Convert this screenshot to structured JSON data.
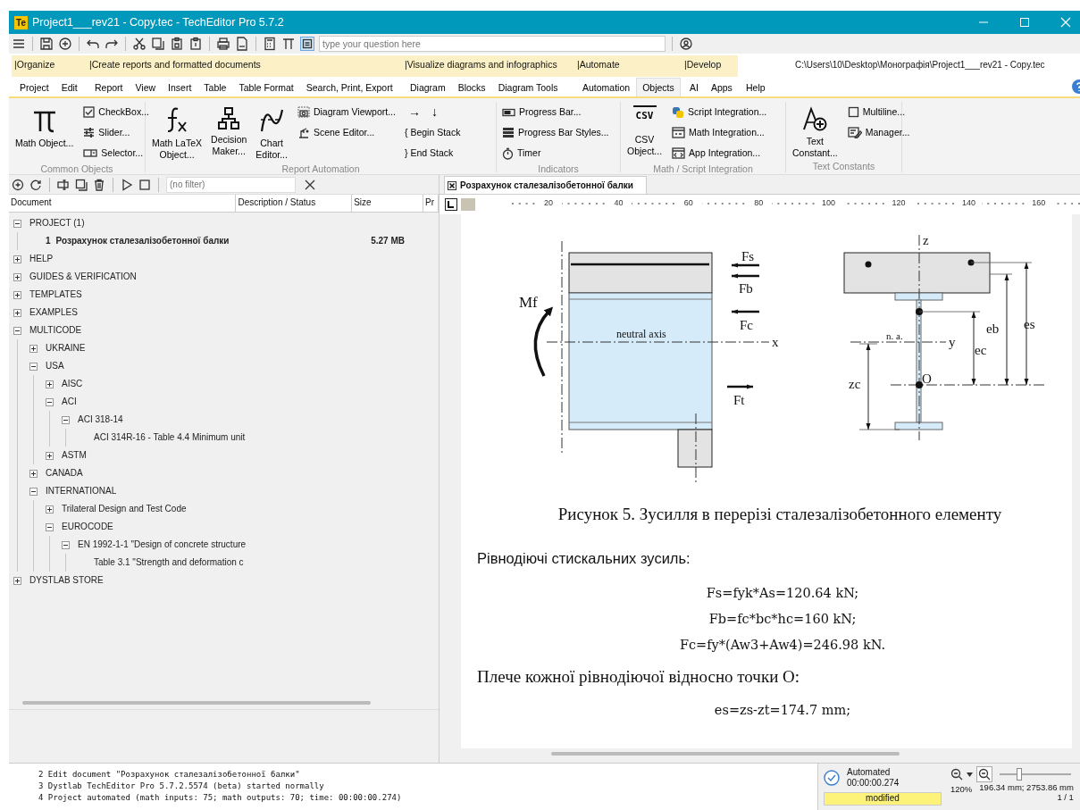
{
  "window": {
    "logo": "Te",
    "title": "Project1___rev21 - Copy.tec - TechEditor Pro 5.7.2"
  },
  "quick_search": {
    "placeholder": "type your question here"
  },
  "ribbon_tabs": {
    "groups": [
      {
        "label": "|Organize",
        "tabs": [
          {
            "label": "Project",
            "selected": false
          },
          {
            "label": "Edit",
            "selected": false
          }
        ]
      },
      {
        "label": "|Create reports and formatted documents",
        "tabs": [
          {
            "label": "Report",
            "selected": false
          },
          {
            "label": "View",
            "selected": false
          },
          {
            "label": "Insert",
            "selected": false
          },
          {
            "label": "Table",
            "selected": false
          },
          {
            "label": "Table Format",
            "selected": false
          },
          {
            "label": "Search, Print, Export",
            "selected": false
          }
        ]
      },
      {
        "label": "|Visualize diagrams and infographics",
        "tabs": [
          {
            "label": "Diagram",
            "selected": false
          },
          {
            "label": "Blocks",
            "selected": false
          },
          {
            "label": "Diagram Tools",
            "selected": false
          }
        ]
      },
      {
        "label": "|Automate",
        "tabs": [
          {
            "label": "Automation",
            "selected": false
          },
          {
            "label": "Objects",
            "selected": true
          }
        ]
      },
      {
        "label": "|Develop",
        "tabs": [
          {
            "label": "AI",
            "selected": false
          },
          {
            "label": "Apps",
            "selected": false
          }
        ]
      },
      {
        "tabs": [
          {
            "label": "Help",
            "selected": false
          }
        ]
      }
    ],
    "file_path": "C:\\Users\\10\\Desktop\\Монографія\\Project1___rev21 - Copy.tec"
  },
  "ribbon": [
    {
      "title": "Common Objects",
      "columns": [
        {
          "kind": "large",
          "items": [
            {
              "label": "Math Object..."
            }
          ]
        },
        {
          "kind": "small",
          "items": [
            {
              "kind": "command",
              "label": "CheckBox..."
            },
            {
              "kind": "command",
              "label": "Slider..."
            },
            {
              "kind": "command",
              "label": "Selector..."
            }
          ]
        }
      ]
    },
    {
      "title": "Report Automation",
      "columns": [
        {
          "kind": "large",
          "items": [
            {
              "label": "Math LaTeX\nObject..."
            },
            {
              "label": "Decision\nMaker..."
            },
            {
              "label": "Chart\nEditor..."
            }
          ]
        },
        {
          "kind": "small",
          "items": [
            {
              "kind": "command",
              "label": "Diagram Viewport..."
            },
            {
              "kind": "command",
              "label": "Scene Editor..."
            }
          ]
        },
        {
          "kind": "small",
          "items": [
            {
              "kind": "glyphs",
              "glyphs": [
                "→",
                "↓"
              ]
            },
            {
              "kind": "command",
              "label": "{ Begin Stack"
            },
            {
              "kind": "command",
              "label": "} End Stack"
            }
          ]
        }
      ]
    },
    {
      "title": "Indicators",
      "columns": [
        {
          "kind": "small",
          "items": [
            {
              "kind": "command",
              "label": "Progress Bar..."
            },
            {
              "kind": "command",
              "label": "Progress Bar Styles..."
            },
            {
              "kind": "command",
              "label": "Timer"
            }
          ]
        }
      ]
    },
    {
      "title": "Math / Script Integration",
      "columns": [
        {
          "kind": "large",
          "items": [
            {
              "label": "CSV\nObject...",
              "icon_text": "CSV"
            }
          ]
        },
        {
          "kind": "small",
          "items": [
            {
              "kind": "command",
              "label": "Script Integration..."
            },
            {
              "kind": "command",
              "label": "Math Integration..."
            },
            {
              "kind": "command",
              "label": "App Integration..."
            }
          ]
        }
      ]
    },
    {
      "title": "Text Constants",
      "columns": [
        {
          "kind": "large",
          "items": [
            {
              "label": "Text\nConstant..."
            }
          ]
        },
        {
          "kind": "small",
          "items": [
            {
              "kind": "command",
              "label": "Multiline..."
            },
            {
              "kind": "command",
              "label": "Manager..."
            }
          ]
        }
      ]
    }
  ],
  "document_tree": {
    "filter": {
      "placeholder": "(no filter)"
    },
    "columns": [
      "Document",
      "Description / Status",
      "Size",
      "Pr"
    ],
    "items": [
      {
        "label": "PROJECT (1)",
        "expanded": true,
        "children": [
          {
            "number": "1",
            "label": "Розрахунок сталезалізобетонної балки",
            "size": "5.27 MB"
          }
        ]
      },
      {
        "label": "HELP",
        "expanded": false
      },
      {
        "label": "GUIDES & VERIFICATION",
        "expanded": false
      },
      {
        "label": "TEMPLATES",
        "expanded": false
      },
      {
        "label": "EXAMPLES",
        "expanded": false
      },
      {
        "label": "MULTICODE",
        "expanded": true,
        "children": [
          {
            "label": "UKRAINE",
            "expanded": false
          },
          {
            "label": "USA",
            "expanded": true,
            "children": [
              {
                "label": "AISC",
                "expanded": false
              },
              {
                "label": "ACI",
                "expanded": true,
                "children": [
                  {
                    "label": "ACI 318-14",
                    "expanded": true,
                    "children": [
                      {
                        "label": "ACI 314R-16 - Table 4.4 Minimum unit"
                      }
                    ]
                  }
                ]
              },
              {
                "label": "ASTM",
                "expanded": false
              }
            ]
          },
          {
            "label": "CANADA",
            "expanded": false
          },
          {
            "label": "INTERNATIONAL",
            "expanded": true,
            "children": [
              {
                "label": "Trilateral Design and Test Code",
                "expanded": false
              },
              {
                "label": "EUROCODE",
                "expanded": true,
                "children": [
                  {
                    "label": "EN 1992-1-1 \"Design of concrete structure",
                    "expanded": true,
                    "children": [
                      {
                        "label": "Table 3.1 \"Strength and deformation c"
                      }
                    ]
                  }
                ]
              }
            ]
          }
        ]
      },
      {
        "label": "DYSTLAB STORE",
        "expanded": false
      }
    ]
  },
  "document": {
    "tab": "Розрахунок сталезалізобетонної балки",
    "ruler": [
      "20",
      "40",
      "60",
      "80",
      "100",
      "120",
      "140",
      "160"
    ],
    "figure": {
      "labels": [
        "Fs",
        "Fb",
        "Mf",
        "Fc",
        "neutral axis",
        "x",
        "Ft",
        "z",
        "n. a.",
        "y",
        "eb",
        "es",
        "ec",
        "zc",
        "O"
      ]
    },
    "paragraphs": [
      {
        "kind": "caption",
        "text": "Рисунок 5. Зусилля в перерізі сталезалізобетонного елементу"
      },
      {
        "kind": "lead",
        "text": "Рівнодіючі стискальних зусиль:"
      },
      {
        "kind": "formula",
        "text": "Fs=fyk*As=120.64 kN;"
      },
      {
        "kind": "formula",
        "text": "Fb=fc*bc*hc=160 kN;"
      },
      {
        "kind": "formula",
        "text": "Fc=fy*(Aw3+Aw4)=246.98 kN."
      },
      {
        "kind": "text",
        "text": "Плече кожної рівнодіючої відносно точки O:"
      },
      {
        "kind": "formula",
        "text": "es=zs-zt=174.7 mm;"
      }
    ]
  },
  "log": [
    "2 Edit document \"Розрахунок сталезалізобетонної балки\"",
    "3 Dystlab TechEditor Pro 5.7.2.5574 (beta) started normally",
    "4 Project automated (math inputs: 75; math outputs: 70; time: 00:00:00.274)"
  ],
  "status": {
    "state": "Automated",
    "time": "00:00:00.274",
    "flag": "modified"
  },
  "zoom": {
    "level": 0.25,
    "percent": "120%",
    "position": "196.34 mm; 2753.86 mm",
    "page": "1 / 1"
  }
}
